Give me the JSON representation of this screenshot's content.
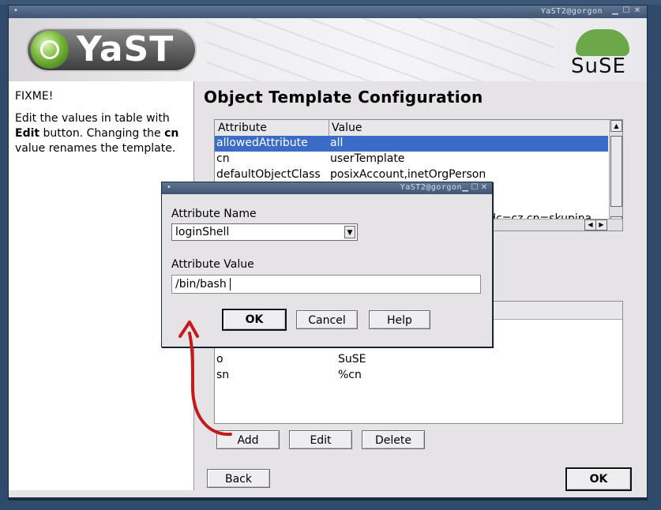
{
  "window": {
    "title": "YaST2@gorgon",
    "controls": [
      "minimize-icon",
      "maximize-icon",
      "close-icon"
    ]
  },
  "banner": {
    "yast_logo_text": "YaST",
    "suse_logo_text": "SuSE"
  },
  "help": {
    "line1": "FIXME!",
    "line2_pre": "Edit the values in table with ",
    "line2_bold": "Edit",
    "line2_mid": " button. Changing the ",
    "line2_bold2": "cn",
    "line2_post": " value renames the template."
  },
  "main": {
    "heading": "Object Template Configuration",
    "table1": {
      "columns": [
        "Attribute",
        "Value"
      ],
      "rows": [
        {
          "attribute": "allowedAttribute",
          "value": "all",
          "selected": true
        },
        {
          "attribute": "cn",
          "value": "userTemplate",
          "selected": false
        },
        {
          "attribute": "defaultObjectClass",
          "value": "posixAccount,inetOrgPerson",
          "selected": false
        }
      ],
      "partial_row_value": "e,dc=cz cn=skupina"
    },
    "table2": {
      "rows": [
        {
          "attribute": "o",
          "value": "SuSE"
        },
        {
          "attribute": "sn",
          "value": "%cn"
        }
      ]
    },
    "buttons": {
      "add": "Add",
      "edit": "Edit",
      "delete": "Delete",
      "back": "Back",
      "ok": "OK"
    }
  },
  "dialog": {
    "title": "YaST2@gorgon",
    "name_label": "Attribute Name",
    "name_value": "loginShell",
    "value_label": "Attribute Value",
    "value_value": "/bin/bash",
    "ok": "OK",
    "cancel": "Cancel",
    "help": "Help"
  },
  "colors": {
    "selection": "#3a6bc7",
    "annotation_arrow": "#c41a1a",
    "titlebar": "#4a6180"
  }
}
